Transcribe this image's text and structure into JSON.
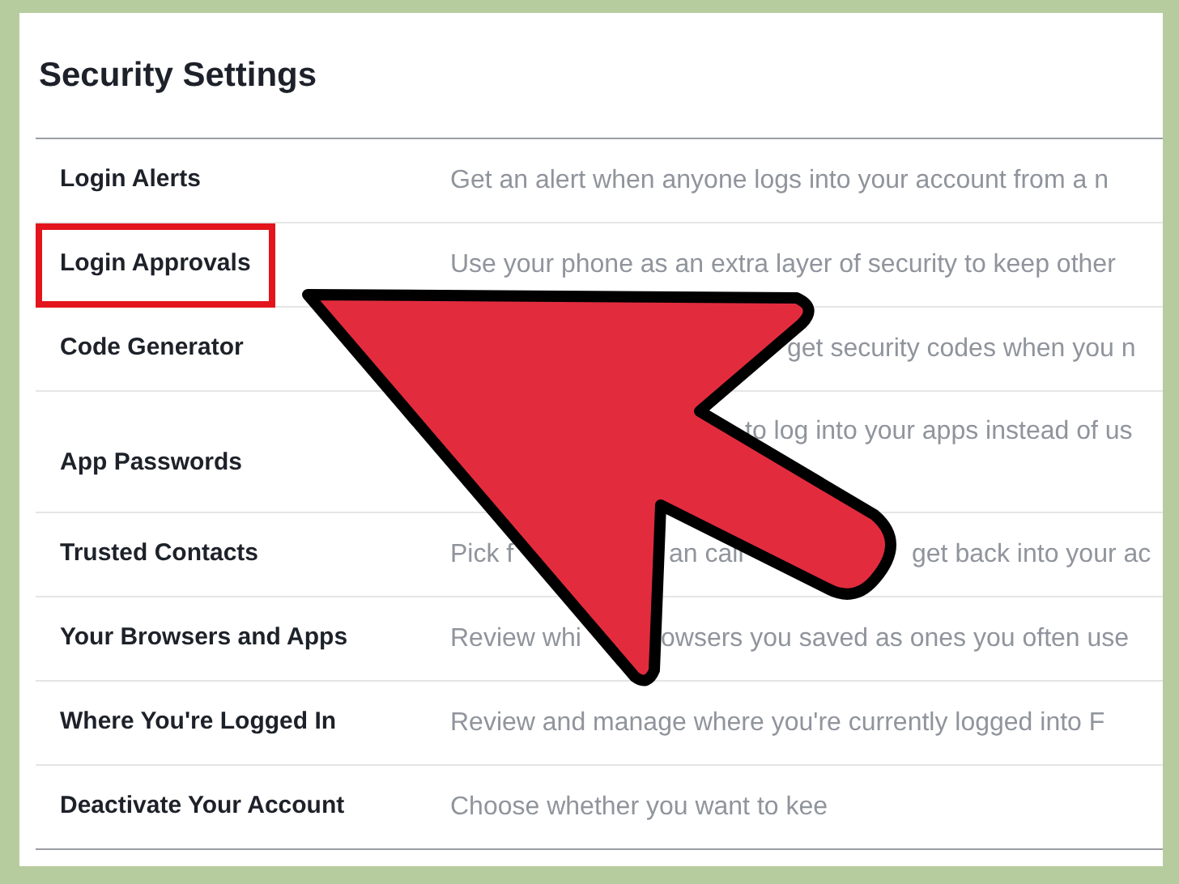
{
  "title": "Security Settings",
  "rows": [
    {
      "label": "Login Alerts",
      "highlighted": false,
      "description": [
        "Get an alert when anyone logs into your account from a n"
      ]
    },
    {
      "label": "Login Approvals",
      "highlighted": true,
      "description": [
        "Use your phone as an extra layer of security to keep other"
      ]
    },
    {
      "label": "Code Generator",
      "highlighted": false,
      "description": [
        "get security codes when you n"
      ]
    },
    {
      "label": "App Passwords",
      "highlighted": false,
      "description": [
        "to log into your apps instead of us"
      ]
    },
    {
      "label": "Trusted Contacts",
      "highlighted": false,
      "description": [
        "Pick f",
        "an call",
        "get back into your ac"
      ]
    },
    {
      "label": "Your Browsers and Apps",
      "highlighted": false,
      "description": [
        "Review whi",
        "owsers you saved as ones you often use"
      ]
    },
    {
      "label": "Where You're Logged In",
      "highlighted": false,
      "description": [
        "Review and manage where you're currently logged into F"
      ]
    },
    {
      "label": "Deactivate Your Account",
      "highlighted": false,
      "description": [
        "Choose whether you want to kee"
      ]
    }
  ]
}
